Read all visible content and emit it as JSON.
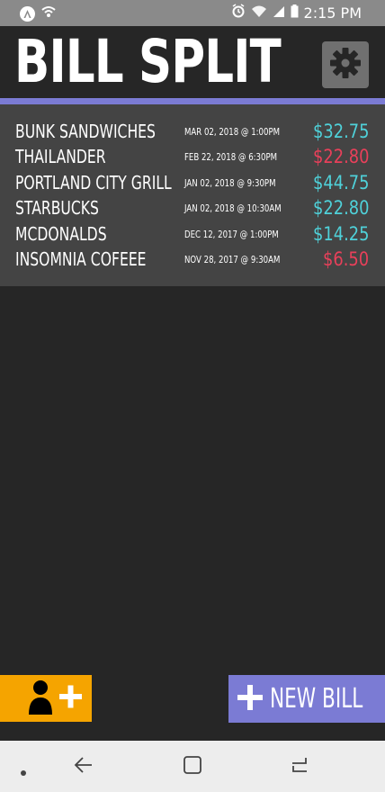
{
  "status_bar": {
    "time": "2:15 PM",
    "left_icons": [
      "app-notification-icon",
      "wifi-call-icon"
    ],
    "right_icons": [
      "alarm-icon",
      "wifi-icon",
      "signal-icon",
      "battery-icon"
    ]
  },
  "header": {
    "title": "BILL SPLIT",
    "settings_icon": "gear-icon"
  },
  "bills": [
    {
      "name": "BUNK SANDWICHES",
      "date": "MAR 02, 2018 @ 1:00PM",
      "amount": "$32.75",
      "status": "positive"
    },
    {
      "name": "THAILANDER",
      "date": "FEB 22, 2018 @ 6:30PM",
      "amount": "$22.80",
      "status": "negative"
    },
    {
      "name": "PORTLAND CITY GRILL",
      "date": "JAN 02, 2018 @ 9:30PM",
      "amount": "$44.75",
      "status": "positive"
    },
    {
      "name": "STARBUCKS",
      "date": "JAN 02, 2018 @ 10:30AM",
      "amount": "$22.80",
      "status": "positive"
    },
    {
      "name": "MCDONALDS",
      "date": "DEC 12, 2017 @ 1:00PM",
      "amount": "$14.25",
      "status": "positive"
    },
    {
      "name": "INSOMNIA COFEEE",
      "date": "NOV 28, 2017 @ 9:30AM",
      "amount": "$6.50",
      "status": "negative"
    }
  ],
  "colors": {
    "positive": "#4fd1d9",
    "negative": "#e8405a",
    "accent": "#7b7bd4",
    "add_person": "#f5a400"
  },
  "actions": {
    "add_person_icon": "add-person-icon",
    "new_bill_label": "NEW BILL",
    "new_bill_icon": "plus-icon"
  },
  "nav_bar": {
    "items": [
      "nav-dot-icon",
      "back-icon",
      "home-icon",
      "recents-icon"
    ]
  }
}
